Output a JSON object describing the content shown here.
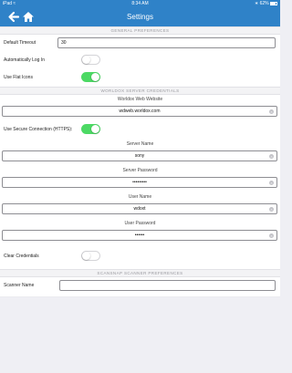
{
  "status_bar": {
    "carrier": "iPad",
    "wifi_icon": "wifi-icon",
    "time": "8:34 AM",
    "battery": "62%"
  },
  "nav": {
    "title": "Settings",
    "back_icon": "back-arrow-icon",
    "home_icon": "home-icon"
  },
  "general": {
    "header": "GENERAL PREFERENCES",
    "default_timeout_label": "Default Timeout",
    "default_timeout_value": "30",
    "auto_login_label": "Automatically Log In",
    "auto_login_on": false,
    "flat_icons_label": "Use Flat Icons",
    "flat_icons_on": true
  },
  "worldox": {
    "header": "WORLDOX SERVER CREDENTIALS",
    "website_label": "Worldox Web Website",
    "website_value": "wdweb.worldox.com",
    "secure_label": "Use Secure Connection (HTTPS):",
    "secure_on": true,
    "server_name_label": "Server Name",
    "server_name_value": "sony",
    "server_password_label": "Server Password",
    "server_password_value": "•••••••••",
    "user_name_label": "User Name",
    "user_name_value": "wdoxt",
    "user_password_label": "User Password",
    "user_password_value": "••••••",
    "clear_label": "Clear Credentials",
    "clear_on": false
  },
  "scansnap": {
    "header": "SCANSNAP SCANNER PREFERENCES",
    "scanner_name_label": "Scanner Name",
    "scanner_name_value": ""
  },
  "colors": {
    "accent": "#2f82c8",
    "toggle_on": "#4cd964",
    "page_bg": "#efeff4"
  }
}
